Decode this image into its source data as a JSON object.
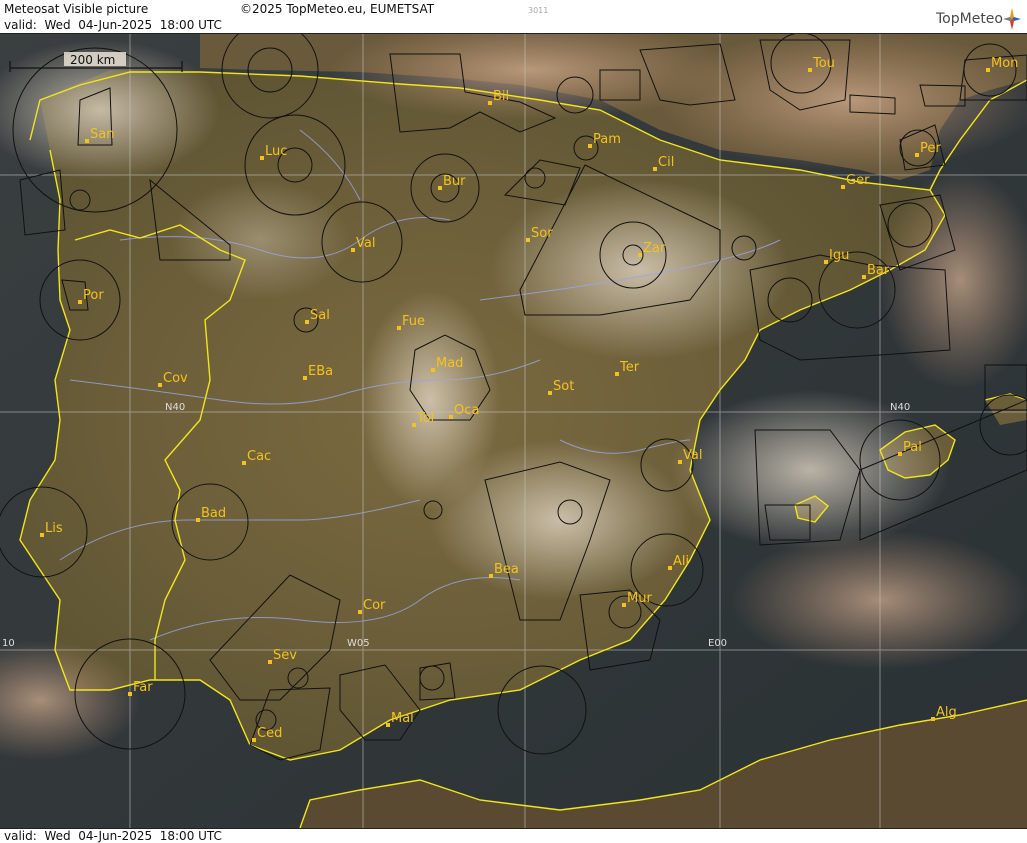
{
  "header": {
    "product_title": "Meteosat Visible picture",
    "copyright": "©2025 TopMeteo.eu, EUMETSAT",
    "valid_prefix": "valid:",
    "valid_time": "Wed  04-Jun-2025  18:00 UTC",
    "image_code": "3011",
    "logo_text": "TopMeteo"
  },
  "footer": {
    "valid_prefix": "valid:",
    "valid_time": "Wed  04-Jun-2025  18:00 UTC"
  },
  "scale_bar": {
    "label": "200 km"
  },
  "grid_labels": {
    "lat_40": "N40",
    "lon_w05": "W05",
    "lon_e00": "E00",
    "lon_w10": "10"
  },
  "cities": [
    {
      "id": "san",
      "name": "San"
    },
    {
      "id": "luc",
      "name": "Luc"
    },
    {
      "id": "bil",
      "name": "Bil"
    },
    {
      "id": "pam",
      "name": "Pam"
    },
    {
      "id": "tou",
      "name": "Tou"
    },
    {
      "id": "mon",
      "name": "Mon"
    },
    {
      "id": "per",
      "name": "Per"
    },
    {
      "id": "cil",
      "name": "Cil"
    },
    {
      "id": "bur",
      "name": "Bur"
    },
    {
      "id": "ger",
      "name": "Ger"
    },
    {
      "id": "sor",
      "name": "Sor"
    },
    {
      "id": "val-n",
      "name": "Val"
    },
    {
      "id": "zar",
      "name": "Zar"
    },
    {
      "id": "igu",
      "name": "Igu"
    },
    {
      "id": "bar",
      "name": "Bar"
    },
    {
      "id": "por",
      "name": "Por"
    },
    {
      "id": "sal",
      "name": "Sal"
    },
    {
      "id": "fue",
      "name": "Fue"
    },
    {
      "id": "mad",
      "name": "Mad"
    },
    {
      "id": "cov",
      "name": "Cov"
    },
    {
      "id": "eba",
      "name": "EBa"
    },
    {
      "id": "ter",
      "name": "Ter"
    },
    {
      "id": "sot",
      "name": "Sot"
    },
    {
      "id": "tol",
      "name": "Tol"
    },
    {
      "id": "oca",
      "name": "Oca"
    },
    {
      "id": "pal",
      "name": "Pal"
    },
    {
      "id": "val-e",
      "name": "Val"
    },
    {
      "id": "cac",
      "name": "Cac"
    },
    {
      "id": "bad",
      "name": "Bad"
    },
    {
      "id": "lis",
      "name": "Lis"
    },
    {
      "id": "ali",
      "name": "Ali"
    },
    {
      "id": "bea",
      "name": "Bea"
    },
    {
      "id": "mur",
      "name": "Mur"
    },
    {
      "id": "cor",
      "name": "Cor"
    },
    {
      "id": "sev",
      "name": "Sev"
    },
    {
      "id": "far",
      "name": "Far"
    },
    {
      "id": "mal",
      "name": "Mal"
    },
    {
      "id": "ced",
      "name": "Ced"
    },
    {
      "id": "alg",
      "name": "Alg"
    }
  ],
  "colors": {
    "coastline": "#f2e51d",
    "city_label": "#f4c21e",
    "airspace": "#111111",
    "rivers": "#9aa6e8",
    "grid": "#c8c8c8",
    "sea": "#30373a",
    "land": "#6b5e3a"
  }
}
